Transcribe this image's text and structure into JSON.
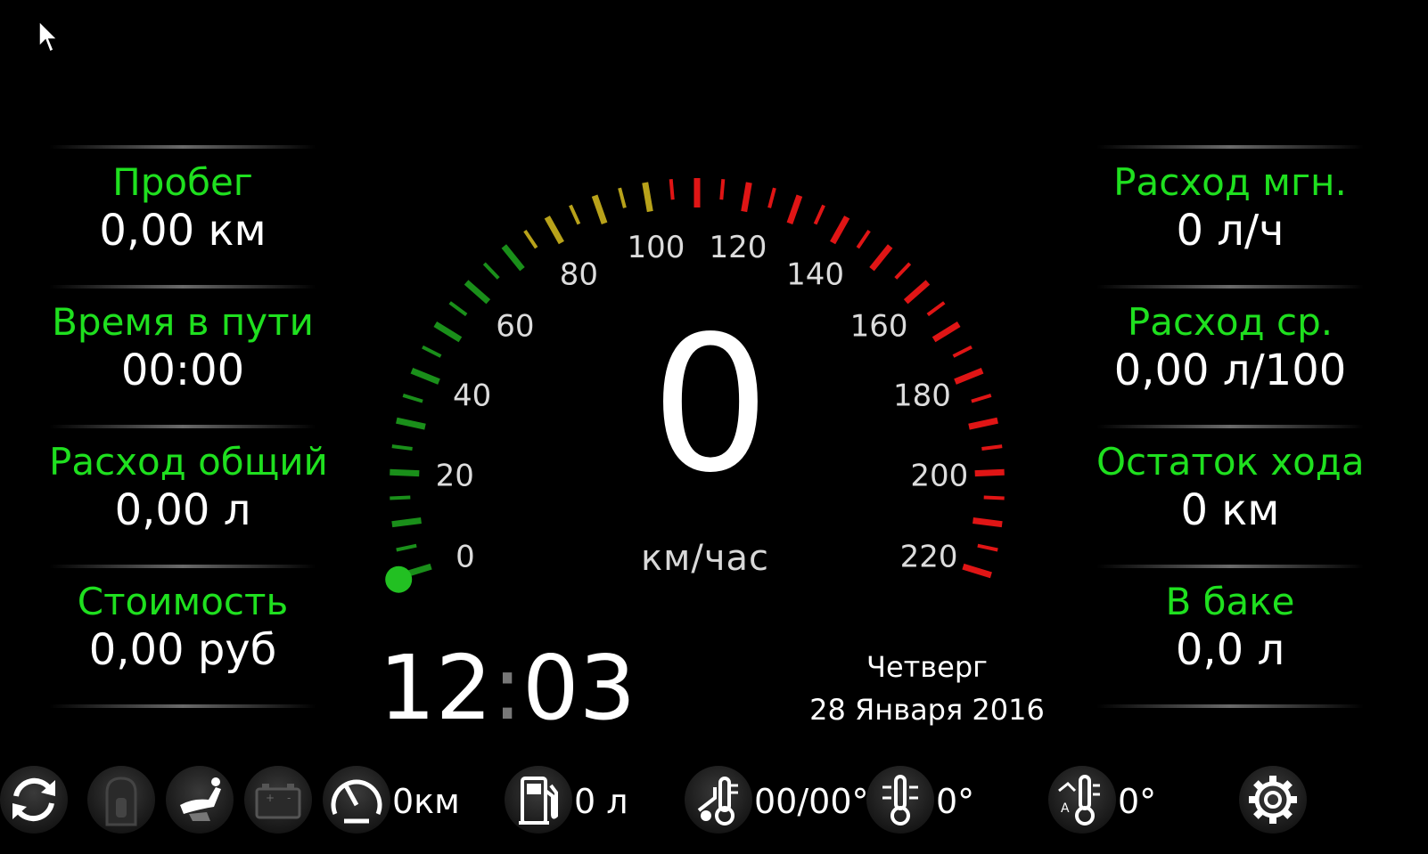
{
  "left_panel": [
    {
      "label": "Пробег",
      "value": "0,00 км"
    },
    {
      "label": "Время в пути",
      "value": "00:00"
    },
    {
      "label": "Расход общий",
      "value": "0,00 л"
    },
    {
      "label": "Стоимость",
      "value": "0,00 руб"
    }
  ],
  "right_panel": [
    {
      "label": "Расход мгн.",
      "value": "0 л/ч"
    },
    {
      "label": "Расход ср.",
      "value": "0,00 л/100"
    },
    {
      "label": "Остаток хода",
      "value": "0 км"
    },
    {
      "label": "В баке",
      "value": "0,0 л"
    }
  ],
  "speedometer": {
    "speed": "0",
    "unit": "км/час",
    "max": 220,
    "scale_labels": [
      "0",
      "20",
      "40",
      "60",
      "80",
      "100",
      "120",
      "140",
      "160",
      "180",
      "200",
      "220"
    ],
    "colors": {
      "green": "#1a8f1a",
      "yellow": "#b8a21a",
      "red": "#e01515",
      "needle_dot": "#22c022"
    }
  },
  "clock": {
    "hours": "12",
    "separator": ":",
    "minutes": "03"
  },
  "date": {
    "weekday": "Четверг",
    "full": "28 Января 2016"
  },
  "bottom_bar": {
    "odometer": "0км",
    "fuel": "0 л",
    "engine_temp": "00/00°",
    "outside_temp": "0°",
    "cabin_temp": "0°",
    "icons": [
      "refresh-icon",
      "car-door-icon",
      "seat-icon",
      "battery-icon",
      "gauge-icon",
      "fuel-pump-icon",
      "engine-temp-icon",
      "outside-temp-icon",
      "climate-temp-icon",
      "gear-icon"
    ]
  },
  "accent_color": "#1fe01f"
}
